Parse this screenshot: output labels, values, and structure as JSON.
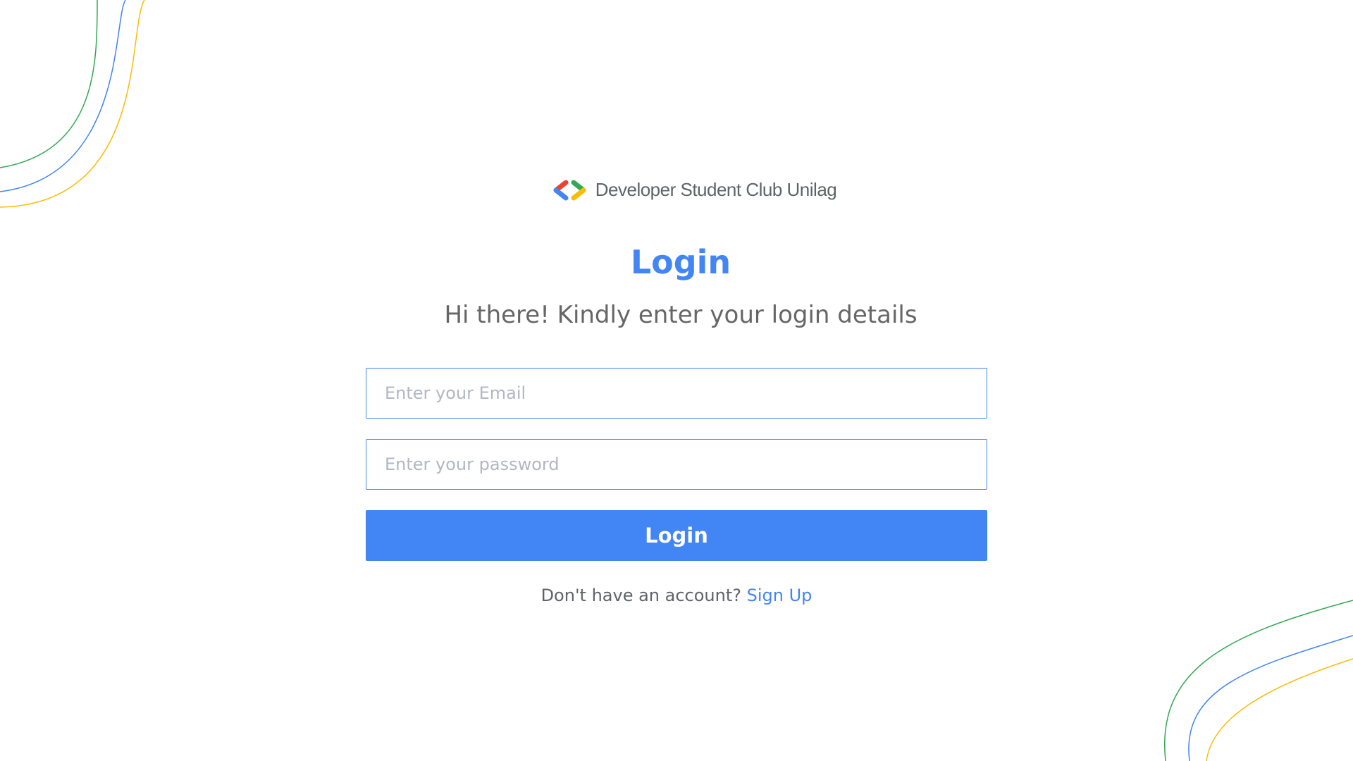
{
  "brand": {
    "name": "Developer Student Club Unilag",
    "logo_icon": "gdsc-brackets-logo-icon",
    "colors": {
      "red": "#ea4335",
      "blue": "#4285f4",
      "green": "#34a853",
      "yellow": "#fbbc04"
    }
  },
  "heading": {
    "title": "Login",
    "subtitle": "Hi there! Kindly enter your login details"
  },
  "form": {
    "email": {
      "value": "",
      "placeholder": "Enter your Email"
    },
    "password": {
      "value": "",
      "placeholder": "Enter your password"
    },
    "submit_label": "Login"
  },
  "footer": {
    "prompt": "Don't have an account?",
    "signup_label": "Sign Up"
  },
  "theme": {
    "accent": "#4285f4",
    "text_muted": "#5f6368",
    "placeholder": "#b3b6c4",
    "decor_green": "#34a853",
    "decor_blue": "#4285f4",
    "decor_yellow": "#fbbc04"
  }
}
